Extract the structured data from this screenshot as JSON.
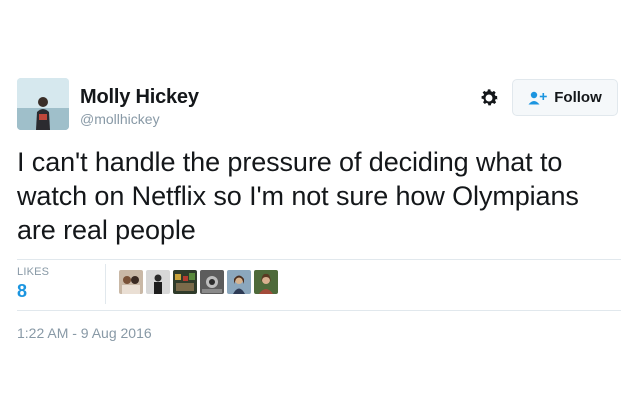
{
  "author": {
    "display_name": "Molly Hickey",
    "handle": "@mollhickey",
    "avatar_icon": "profile-photo"
  },
  "actions": {
    "settings_icon": "gear-icon",
    "follow_label": "Follow",
    "follow_icon": "add-person-icon"
  },
  "tweet": {
    "text": "I can't handle the pressure of deciding what to watch on Netflix so I'm not sure how Olympians are real people",
    "timestamp": "1:22 AM - 9 Aug 2016"
  },
  "stats": {
    "likes_label": "LIKES",
    "likes_count": "8"
  },
  "likers": [
    {
      "name": "liker-1"
    },
    {
      "name": "liker-2"
    },
    {
      "name": "liker-3"
    },
    {
      "name": "liker-4"
    },
    {
      "name": "liker-5"
    },
    {
      "name": "liker-6"
    }
  ],
  "colors": {
    "accent": "#1b95e0",
    "text": "#14171a",
    "muted": "#8899a6",
    "border": "#e1e8ed",
    "button_bg": "#f5f8fa"
  }
}
